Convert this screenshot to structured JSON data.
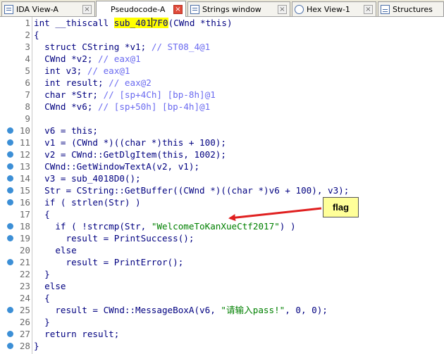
{
  "tabs": [
    {
      "label": "IDA View-A",
      "icon": "disassembly-icon",
      "active": false
    },
    {
      "label": "Pseudocode-A",
      "icon": "pseudocode-icon",
      "active": true
    },
    {
      "label": "Strings window",
      "icon": "strings-icon",
      "active": false
    },
    {
      "label": "Hex View-1",
      "icon": "hex-icon",
      "active": false
    },
    {
      "label": "Structures",
      "icon": "structures-icon",
      "active": false
    }
  ],
  "close_glyph": "×",
  "code_lines": [
    {
      "n": "1",
      "dot": false,
      "seg": [
        [
          "int __thiscall ",
          ""
        ],
        [
          "sub_401",
          "hl"
        ],
        [
          "7F0",
          "hl"
        ],
        [
          "(CWnd *this)",
          ""
        ]
      ]
    },
    {
      "n": "2",
      "dot": false,
      "seg": [
        [
          "{",
          ""
        ]
      ]
    },
    {
      "n": "3",
      "dot": false,
      "seg": [
        [
          "  struct CString *v1; ",
          ""
        ],
        [
          "// ST08_4@1",
          "cm"
        ]
      ]
    },
    {
      "n": "4",
      "dot": false,
      "seg": [
        [
          "  CWnd *v2; ",
          ""
        ],
        [
          "// eax@1",
          "cm"
        ]
      ]
    },
    {
      "n": "5",
      "dot": false,
      "seg": [
        [
          "  int v3; ",
          ""
        ],
        [
          "// eax@1",
          "cm"
        ]
      ]
    },
    {
      "n": "6",
      "dot": false,
      "seg": [
        [
          "  int result; ",
          ""
        ],
        [
          "// eax@2",
          "cm"
        ]
      ]
    },
    {
      "n": "7",
      "dot": false,
      "seg": [
        [
          "  char *Str; ",
          ""
        ],
        [
          "// [sp+4Ch] [bp-8h]@1",
          "cm"
        ]
      ]
    },
    {
      "n": "8",
      "dot": false,
      "seg": [
        [
          "  CWnd *v6; ",
          ""
        ],
        [
          "// [sp+50h] [bp-4h]@1",
          "cm"
        ]
      ]
    },
    {
      "n": "9",
      "dot": false,
      "seg": [
        [
          "",
          ""
        ]
      ]
    },
    {
      "n": "10",
      "dot": true,
      "seg": [
        [
          "  v6 = this;",
          ""
        ]
      ]
    },
    {
      "n": "11",
      "dot": true,
      "seg": [
        [
          "  v1 = (CWnd *)((char *)this + 100);",
          ""
        ]
      ]
    },
    {
      "n": "12",
      "dot": true,
      "seg": [
        [
          "  v2 = CWnd::GetDlgItem(this, 1002);",
          ""
        ]
      ]
    },
    {
      "n": "13",
      "dot": true,
      "seg": [
        [
          "  CWnd::GetWindowTextA(v2, v1);",
          ""
        ]
      ]
    },
    {
      "n": "14",
      "dot": true,
      "seg": [
        [
          "  v3 = sub_4018D0();",
          ""
        ]
      ]
    },
    {
      "n": "15",
      "dot": true,
      "seg": [
        [
          "  Str = CString::GetBuffer((CWnd *)((char *)v6 + 100), v3);",
          ""
        ]
      ]
    },
    {
      "n": "16",
      "dot": true,
      "seg": [
        [
          "  if ( strlen(Str) )",
          ""
        ]
      ]
    },
    {
      "n": "17",
      "dot": false,
      "seg": [
        [
          "  {",
          ""
        ]
      ]
    },
    {
      "n": "18",
      "dot": true,
      "seg": [
        [
          "    if ( !strcmp(Str, ",
          ""
        ],
        [
          "\"WelcomeToKanXueCtf2017\"",
          "str"
        ],
        [
          ") )",
          ""
        ]
      ]
    },
    {
      "n": "19",
      "dot": true,
      "seg": [
        [
          "      result = PrintSuccess();",
          ""
        ]
      ]
    },
    {
      "n": "20",
      "dot": false,
      "seg": [
        [
          "    else",
          ""
        ]
      ]
    },
    {
      "n": "21",
      "dot": true,
      "seg": [
        [
          "      result = PrintError();",
          ""
        ]
      ]
    },
    {
      "n": "22",
      "dot": false,
      "seg": [
        [
          "  }",
          ""
        ]
      ]
    },
    {
      "n": "23",
      "dot": false,
      "seg": [
        [
          "  else",
          ""
        ]
      ]
    },
    {
      "n": "24",
      "dot": false,
      "seg": [
        [
          "  {",
          ""
        ]
      ]
    },
    {
      "n": "25",
      "dot": true,
      "seg": [
        [
          "    result = CWnd::MessageBoxA(v6, ",
          ""
        ],
        [
          "\"请输入pass!\"",
          "str"
        ],
        [
          ", 0, 0);",
          ""
        ]
      ]
    },
    {
      "n": "26",
      "dot": false,
      "seg": [
        [
          "  }",
          ""
        ]
      ]
    },
    {
      "n": "27",
      "dot": true,
      "seg": [
        [
          "  return result;",
          ""
        ]
      ]
    },
    {
      "n": "28",
      "dot": true,
      "seg": [
        [
          "}",
          ""
        ]
      ]
    }
  ],
  "annotation": {
    "label": "flag",
    "arrow_color": "#e02020",
    "box_color": "#ffff99"
  },
  "colors": {
    "code": "#000080",
    "comment": "#6a6af0",
    "string": "#008000",
    "highlight": "#ffff00",
    "breakpoint_dot": "#3c8fd6"
  }
}
